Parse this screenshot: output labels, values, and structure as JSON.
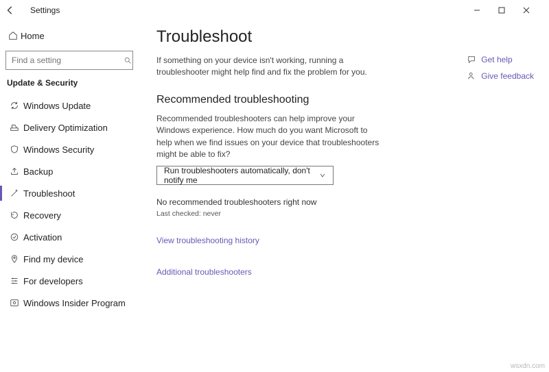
{
  "titlebar": {
    "title": "Settings"
  },
  "sidebar": {
    "home": "Home",
    "search_placeholder": "Find a setting",
    "section": "Update & Security",
    "items": [
      {
        "label": "Windows Update"
      },
      {
        "label": "Delivery Optimization"
      },
      {
        "label": "Windows Security"
      },
      {
        "label": "Backup"
      },
      {
        "label": "Troubleshoot"
      },
      {
        "label": "Recovery"
      },
      {
        "label": "Activation"
      },
      {
        "label": "Find my device"
      },
      {
        "label": "For developers"
      },
      {
        "label": "Windows Insider Program"
      }
    ]
  },
  "main": {
    "title": "Troubleshoot",
    "intro": "If something on your device isn't working, running a troubleshooter might help find and fix the problem for you.",
    "recommended_header": "Recommended troubleshooting",
    "recommended_text": "Recommended troubleshooters can help improve your Windows experience. How much do you want Microsoft to help when we find issues on your device that troubleshooters might be able to fix?",
    "dropdown_value": "Run troubleshooters automatically, don't notify me",
    "no_recommended": "No recommended troubleshooters right now",
    "last_checked": "Last checked: never",
    "history_link": "View troubleshooting history",
    "additional_link": "Additional troubleshooters"
  },
  "right": {
    "get_help": "Get help",
    "give_feedback": "Give feedback"
  },
  "watermark": "wsxdn.com"
}
